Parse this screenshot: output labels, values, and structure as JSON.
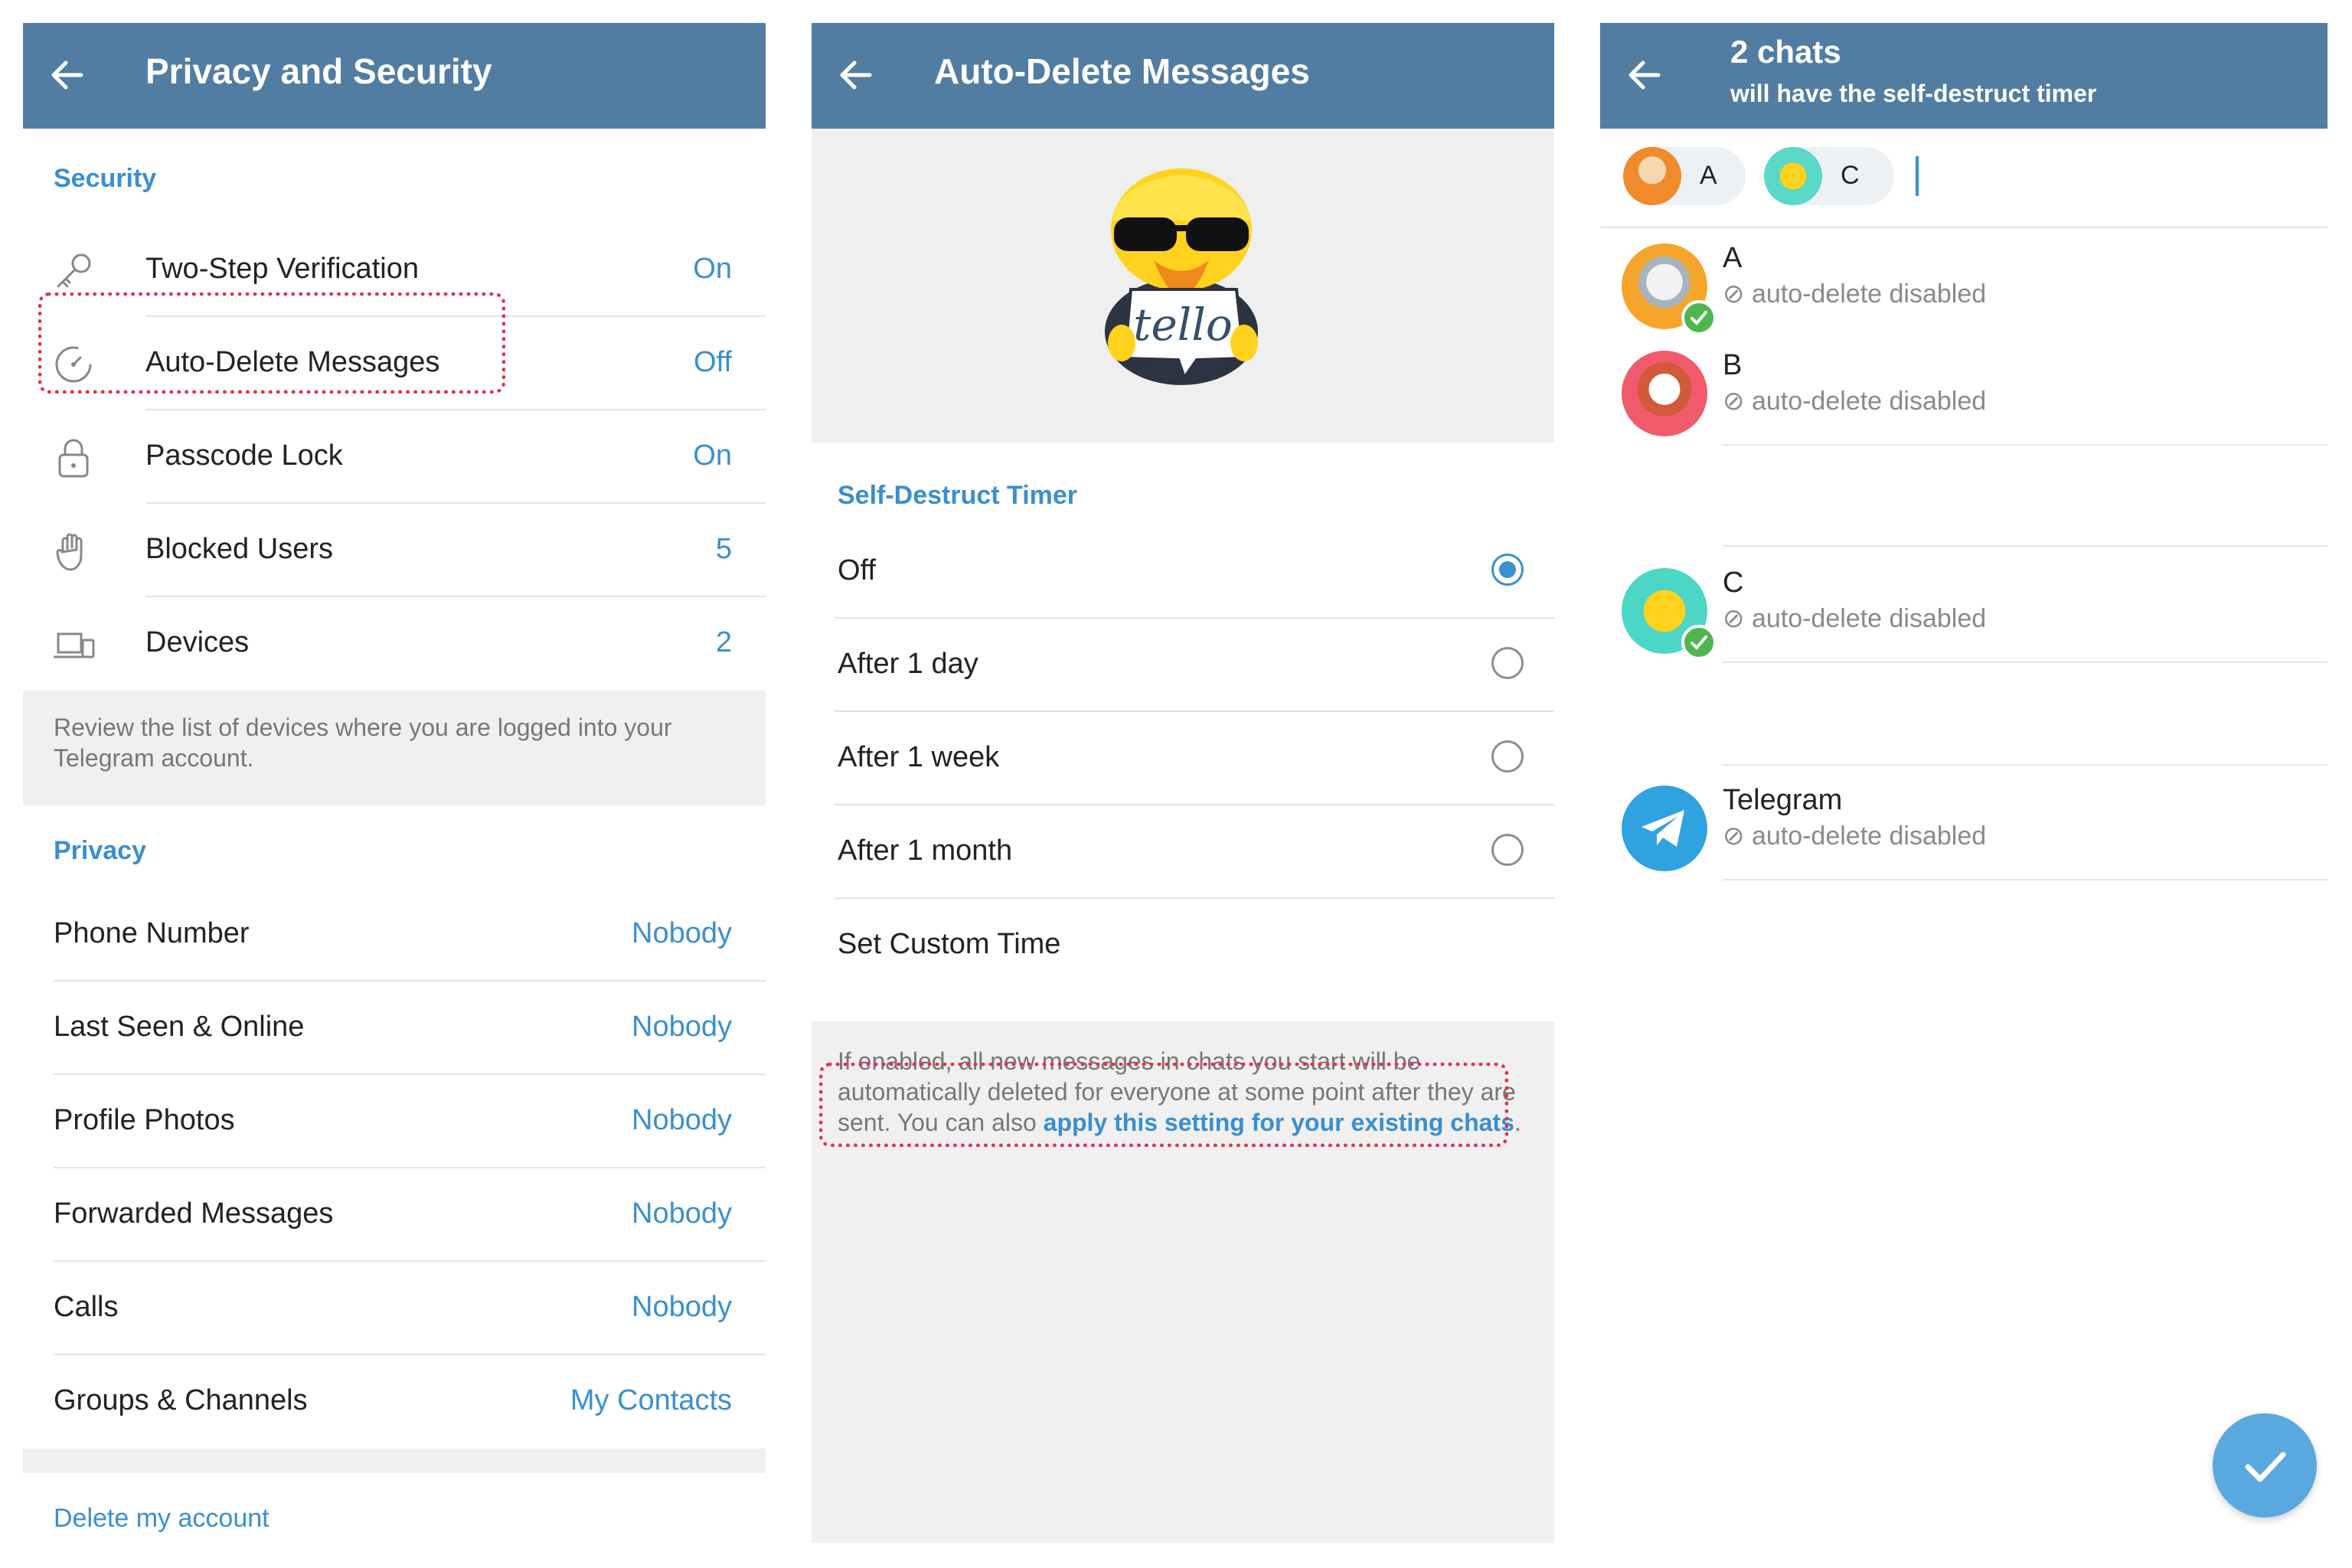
{
  "panel1": {
    "header": {
      "title": "Privacy and Security"
    },
    "security": {
      "title": "Security",
      "items": [
        {
          "label": "Two-Step Verification",
          "value": "On",
          "icon": "key-icon"
        },
        {
          "label": "Auto-Delete Messages",
          "value": "Off",
          "icon": "timer-icon"
        },
        {
          "label": "Passcode Lock",
          "value": "On",
          "icon": "lock-icon"
        },
        {
          "label": "Blocked Users",
          "value": "5",
          "icon": "hand-icon"
        },
        {
          "label": "Devices",
          "value": "2",
          "icon": "devices-icon"
        }
      ],
      "hint": "Review the list of devices where you are logged into your Telegram account."
    },
    "privacy": {
      "title": "Privacy",
      "items": [
        {
          "label": "Phone Number",
          "value": "Nobody"
        },
        {
          "label": "Last Seen & Online",
          "value": "Nobody"
        },
        {
          "label": "Profile Photos",
          "value": "Nobody"
        },
        {
          "label": "Forwarded Messages",
          "value": "Nobody"
        },
        {
          "label": "Calls",
          "value": "Nobody"
        },
        {
          "label": "Groups & Channels",
          "value": "My Contacts"
        }
      ]
    },
    "delete_account": "Delete my account"
  },
  "panel2": {
    "header": {
      "title": "Auto-Delete Messages"
    },
    "sticker_text": "tello",
    "section_title": "Self-Destruct Timer",
    "options": [
      {
        "label": "Off",
        "selected": true
      },
      {
        "label": "After 1 day",
        "selected": false
      },
      {
        "label": "After 1 week",
        "selected": false
      },
      {
        "label": "After 1 month",
        "selected": false
      }
    ],
    "custom": "Set Custom Time",
    "info_text": "If enabled, all new messages in chats you start will be automatically deleted for everyone at some point after they are sent. You can also ",
    "info_link": "apply this setting for your existing chats",
    "info_end": "."
  },
  "panel3": {
    "header": {
      "title": "2 chats",
      "subtitle": "will have the self-destruct timer"
    },
    "chips": [
      {
        "name": "A"
      },
      {
        "name": "C"
      }
    ],
    "chats": [
      {
        "name": "A",
        "status": "auto-delete disabled",
        "selected": true
      },
      {
        "name": "B",
        "status": "auto-delete disabled",
        "selected": false
      },
      {
        "name": "C",
        "status": "auto-delete disabled",
        "selected": true
      },
      {
        "name": "Telegram",
        "status": "auto-delete disabled",
        "selected": false
      }
    ]
  },
  "colors": {
    "header": "#517da2",
    "accent": "#3a8fd0",
    "highlight": "#e0324f",
    "check": "#4fb64f"
  }
}
